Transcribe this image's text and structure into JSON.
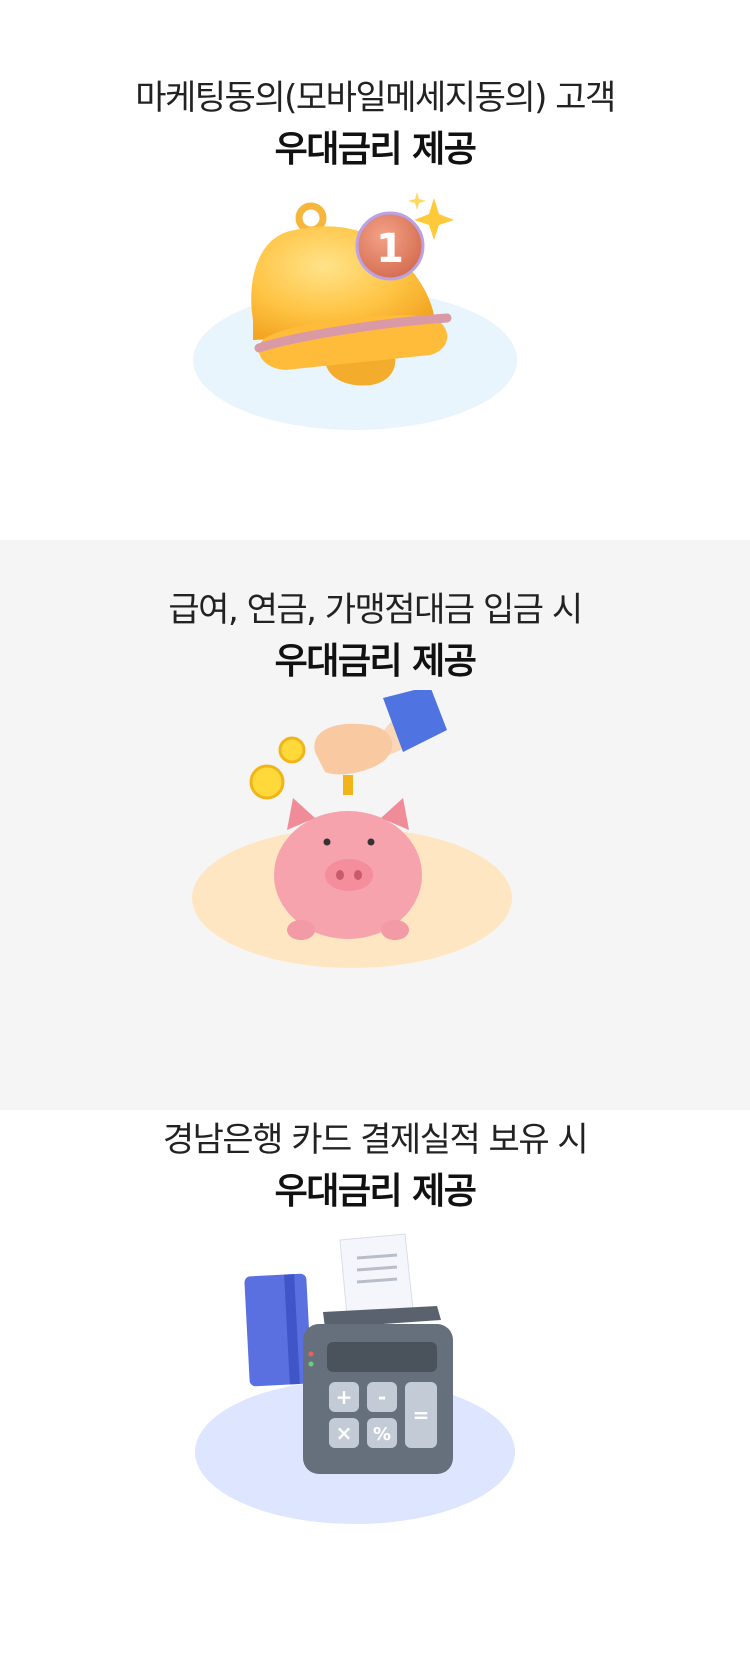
{
  "sections": [
    {
      "subtitle": "마케팅동의(모바일메세지동의) 고객",
      "title": "우대금리 제공",
      "illustration": "bell-notification-icon",
      "badge_text": "1",
      "ellipse_color": "#e9f5fc"
    },
    {
      "subtitle": "급여, 연금, 가맹점대금 입금 시",
      "title": "우대금리 제공",
      "illustration": "piggy-bank-icon",
      "ellipse_color": "#ffe6c2"
    },
    {
      "subtitle": "경남은행 카드 결제실적 보유 시",
      "title": "우대금리 제공",
      "illustration": "card-payment-terminal-icon",
      "keys": [
        "+",
        "-",
        "×",
        "%",
        "="
      ],
      "ellipse_color": "#dde5ff"
    }
  ],
  "colors": {
    "background": "#ffffff",
    "band_background": "#f5f5f5",
    "text": "#111111"
  }
}
